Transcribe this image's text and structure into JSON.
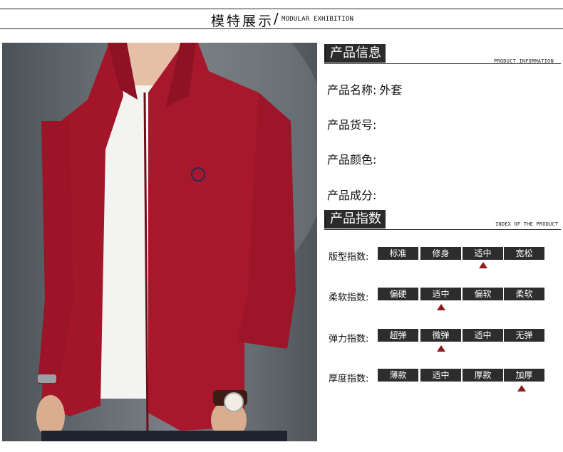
{
  "header": {
    "title": "模特展示",
    "slash": "/",
    "subtitle": "MODULAR EXHIBITION"
  },
  "info": {
    "title": "产品信息",
    "subtitle": "PRODUCT INFORMATION",
    "rows": [
      {
        "label": "产品名称:",
        "value": "外套"
      },
      {
        "label": "产品货号:",
        "value": ""
      },
      {
        "label": "产品颜色:",
        "value": ""
      },
      {
        "label": "产品成分:",
        "value": ""
      }
    ]
  },
  "index": {
    "title": "产品指数",
    "subtitle": "INDEX OF THE PRODUCT",
    "rows": [
      {
        "label": "版型指数:",
        "options": [
          "标准",
          "修身",
          "适中",
          "宽松"
        ],
        "selected": 2
      },
      {
        "label": "柔软指数:",
        "options": [
          "偏硬",
          "适中",
          "偏软",
          "柔软"
        ],
        "selected": 1
      },
      {
        "label": "弹力指数:",
        "options": [
          "超弹",
          "微弹",
          "适中",
          "无弹"
        ],
        "selected": 1
      },
      {
        "label": "厚度指数:",
        "options": [
          "薄款",
          "适中",
          "厚款",
          "加厚"
        ],
        "selected": 3
      }
    ]
  },
  "colors": {
    "chip": "#2d2d2d",
    "marker": "#8b1a1a",
    "jacket": "#a3162a"
  },
  "photo": {
    "subject": "model-wearing-red-fleece-jacket"
  }
}
